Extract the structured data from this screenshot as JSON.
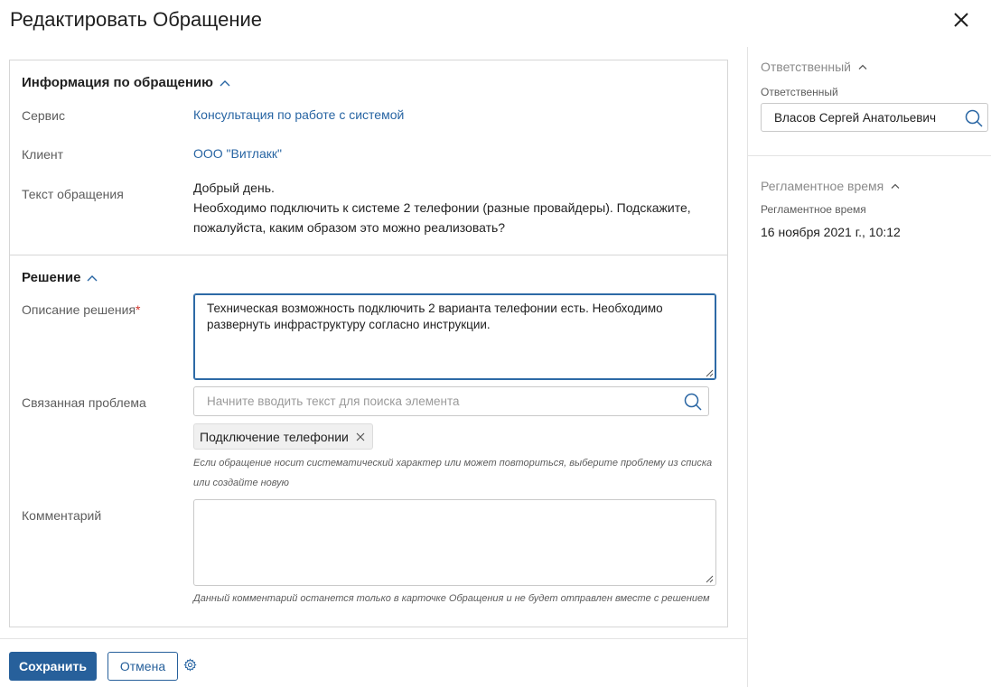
{
  "title": "Редактировать Обращение",
  "info_section": {
    "header": "Информация по обращению",
    "service_label": "Сервис",
    "service_value": "Консультация по работе с системой",
    "client_label": "Клиент",
    "client_value": "ООО \"Витлакк\"",
    "text_label": "Текст обращения",
    "text_lines": [
      "Добрый день.",
      "Необходимо подключить к системе 2 телефонии (разные провайдеры). Подскажите,",
      "пожалуйста, каким образом это можно реализовать?"
    ]
  },
  "solution_section": {
    "header": "Решение",
    "description_label": "Описание решения",
    "required_mark": "*",
    "description_lines": [
      "Техническая возможность подключить 2 варианта телефонии есть. Необходимо",
      "развернуть инфраструктуру согласно инструкции."
    ],
    "related_problem_label": "Связанная проблема",
    "related_problem_placeholder": "Начните вводить текст для поиска элемента",
    "related_problem_chip": "Подключение телефонии",
    "related_problem_hint_lines": [
      "Если обращение носит систематический характер или может повториться, выберите проблему из списка",
      "или создайте новую"
    ],
    "comment_label": "Комментарий",
    "comment_value": "",
    "comment_hint": "Данный комментарий останется только в карточке Обращения и не будет отправлен вместе с решением"
  },
  "sidebar": {
    "responsible_header": "Ответственный",
    "responsible_label": "Ответственный",
    "responsible_value": "Власов Сергей Анатольевич",
    "deadline_header": "Регламентное время",
    "deadline_label": "Регламентное время",
    "deadline_value": "16 ноября 2021 г., 10:12"
  },
  "footer": {
    "save_label": "Сохранить",
    "cancel_label": "Отмена"
  },
  "icons": {
    "close": "close-icon",
    "search": "search-icon",
    "chevron": "chevron-up-icon",
    "chip_remove": "close-icon",
    "settings": "gear-icon"
  },
  "colors": {
    "accent": "#27609b",
    "link": "#2865a3",
    "focus_border": "#2d6aa6",
    "required": "#d0342c"
  }
}
